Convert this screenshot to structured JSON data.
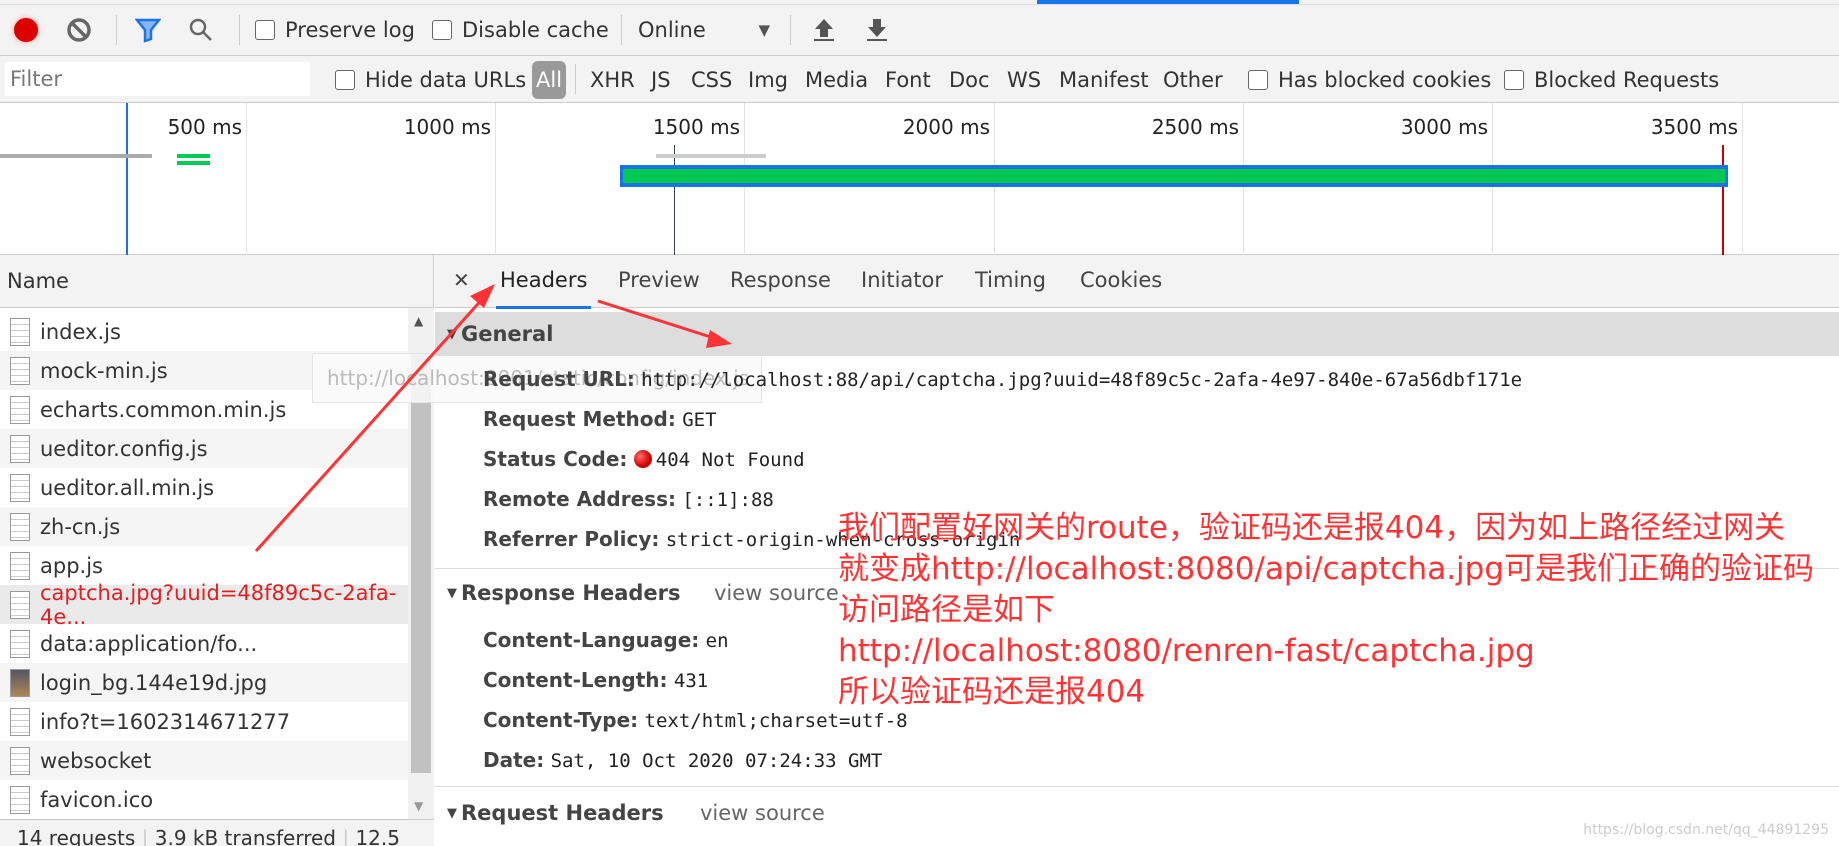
{
  "toolbar": {
    "preserve_log": "Preserve log",
    "disable_cache": "Disable cache",
    "throttle": "Online",
    "icons": [
      "record-icon",
      "clear-icon",
      "filter-icon",
      "search-icon",
      "import-icon",
      "export-icon"
    ]
  },
  "filterbar": {
    "placeholder": "Filter",
    "hide_data_urls": "Hide data URLs",
    "types": [
      "All",
      "XHR",
      "JS",
      "CSS",
      "Img",
      "Media",
      "Font",
      "Doc",
      "WS",
      "Manifest",
      "Other"
    ],
    "has_blocked_cookies": "Has blocked cookies",
    "blocked_requests": "Blocked Requests"
  },
  "timeline": {
    "ticks": [
      "500 ms",
      "1000 ms",
      "1500 ms",
      "2000 ms",
      "2500 ms",
      "3000 ms",
      "3500 ms"
    ]
  },
  "names": {
    "header": "Name",
    "rows": [
      "index.js",
      "mock-min.js",
      "echarts.common.min.js",
      "ueditor.config.js",
      "ueditor.all.min.js",
      "zh-cn.js",
      "app.js",
      "captcha.jpg?uuid=48f89c5c-2afa-4e...",
      "data:application/fo...",
      "login_bg.144e19d.jpg",
      "info?t=1602314671277",
      "websocket",
      "favicon.ico"
    ],
    "error_color": "#e02020"
  },
  "footer": {
    "requests": "14 requests",
    "transferred": "3.9 kB transferred",
    "resources": "12.5"
  },
  "tooltip": "http://localhost:8001/static/config/index.js",
  "tabs": [
    "Headers",
    "Preview",
    "Response",
    "Initiator",
    "Timing",
    "Cookies"
  ],
  "general": {
    "title": "General",
    "items": [
      {
        "k": "Request URL:",
        "v": "http://localhost:88/api/captcha.jpg?uuid=48f89c5c-2afa-4e97-840e-67a56dbf171e"
      },
      {
        "k": "Request Method:",
        "v": "GET"
      },
      {
        "k": "Status Code:",
        "v": "404 Not Found"
      },
      {
        "k": "Remote Address:",
        "v": "[::1]:88"
      },
      {
        "k": "Referrer Policy:",
        "v": "strict-origin-when-cross-origin"
      }
    ]
  },
  "response_headers": {
    "title": "Response Headers",
    "view_source": "view source",
    "items": [
      {
        "k": "Content-Language:",
        "v": "en"
      },
      {
        "k": "Content-Length:",
        "v": "431"
      },
      {
        "k": "Content-Type:",
        "v": "text/html;charset=utf-8"
      },
      {
        "k": "Date:",
        "v": "Sat, 10 Oct 2020 07:24:33 GMT"
      }
    ]
  },
  "request_headers": {
    "title": "Request Headers",
    "view_source": "view source"
  },
  "annotation": [
    "我们配置好网关的route，验证码还是报404，因为如上路径经过网关",
    "就变成http://localhost:8080/api/captcha.jpg可是我们正确的验证码",
    "访问路径是如下",
    "http://localhost:8080/renren-fast/captcha.jpg",
    "所以验证码还是报404"
  ],
  "watermark": "https://blog.csdn.net/qq_44891295"
}
